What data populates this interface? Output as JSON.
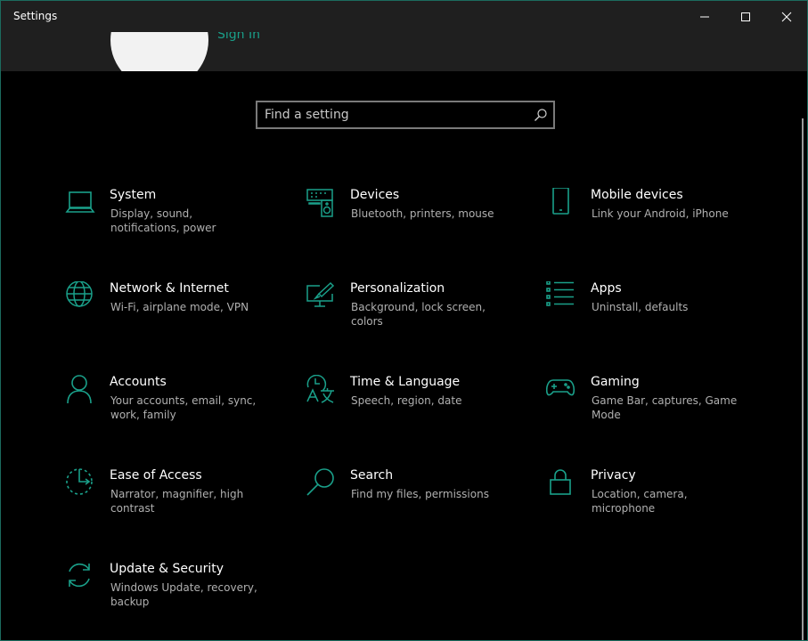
{
  "window": {
    "title": "Settings"
  },
  "header": {
    "signin_label": "Sign In"
  },
  "search": {
    "placeholder": "Find a setting"
  },
  "accent_color": "#1aa08a",
  "tiles": [
    {
      "title": "System",
      "description": "Display, sound, notifications, power",
      "icon": "laptop-icon"
    },
    {
      "title": "Devices",
      "description": "Bluetooth, printers, mouse",
      "icon": "keyboard-speaker-icon"
    },
    {
      "title": "Mobile devices",
      "description": "Link your Android, iPhone",
      "icon": "phone-icon"
    },
    {
      "title": "Network & Internet",
      "description": "Wi-Fi, airplane mode, VPN",
      "icon": "globe-icon"
    },
    {
      "title": "Personalization",
      "description": "Background, lock screen, colors",
      "icon": "paintbrush-monitor-icon"
    },
    {
      "title": "Apps",
      "description": "Uninstall, defaults",
      "icon": "apps-list-icon"
    },
    {
      "title": "Accounts",
      "description": "Your accounts, email, sync, work, family",
      "icon": "person-icon"
    },
    {
      "title": "Time & Language",
      "description": "Speech, region, date",
      "icon": "time-language-icon"
    },
    {
      "title": "Gaming",
      "description": "Game Bar, captures, Game Mode",
      "icon": "gamepad-icon"
    },
    {
      "title": "Ease of Access",
      "description": "Narrator, magnifier, high contrast",
      "icon": "ease-of-access-icon"
    },
    {
      "title": "Search",
      "description": "Find my files, permissions",
      "icon": "magnifier-icon"
    },
    {
      "title": "Privacy",
      "description": "Location, camera, microphone",
      "icon": "lock-icon"
    },
    {
      "title": "Update & Security",
      "description": "Windows Update, recovery, backup",
      "icon": "refresh-icon"
    }
  ]
}
